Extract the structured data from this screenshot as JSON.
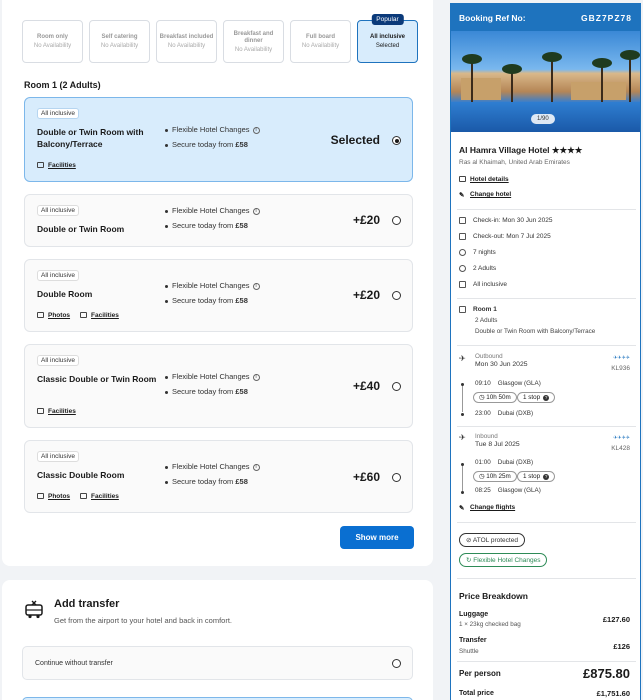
{
  "boards": [
    {
      "name": "Room only",
      "status": "No Availability"
    },
    {
      "name": "Self catering",
      "status": "No Availability"
    },
    {
      "name": "Breakfast included",
      "status": "No Availability"
    },
    {
      "name": "Breakfast and dinner",
      "status": "No Availability"
    },
    {
      "name": "Full board",
      "status": "No Availability"
    },
    {
      "name": "All inclusive",
      "status": "Selected",
      "badge": "Popular"
    }
  ],
  "room_heading": "Room 1 (2 Adults)",
  "rooms": [
    {
      "tag": "All inclusive",
      "name": "Double or Twin Room with Balcony/Terrace",
      "feature1": "Flexible Hotel Changes",
      "feature2_prefix": "Secure today from",
      "feature2_price": "£58",
      "price": "Selected",
      "links": [
        "Facilities"
      ]
    },
    {
      "tag": "All inclusive",
      "name": "Double or Twin Room",
      "feature1": "Flexible Hotel Changes",
      "feature2_prefix": "Secure today from",
      "feature2_price": "£58",
      "price": "+£20",
      "links": []
    },
    {
      "tag": "All inclusive",
      "name": "Double Room",
      "feature1": "Flexible Hotel Changes",
      "feature2_prefix": "Secure today from",
      "feature2_price": "£58",
      "price": "+£20",
      "links": [
        "Photos",
        "Facilities"
      ]
    },
    {
      "tag": "All inclusive",
      "name": "Classic Double or Twin Room",
      "feature1": "Flexible Hotel Changes",
      "feature2_prefix": "Secure today from",
      "feature2_price": "£58",
      "price": "+£40",
      "links": [
        "Facilities"
      ]
    },
    {
      "tag": "All inclusive",
      "name": "Classic Double Room",
      "feature1": "Flexible Hotel Changes",
      "feature2_prefix": "Secure today from",
      "feature2_price": "£58",
      "price": "+£60",
      "links": [
        "Photos",
        "Facilities"
      ]
    }
  ],
  "show_more": "Show more",
  "transfer": {
    "title": "Add transfer",
    "subtitle": "Get from the airport to your hotel and back in comfort.",
    "option1": "Continue without transfer"
  },
  "booking": {
    "ref_label": "Booking Ref No:",
    "ref_code": "GBZ7PZ78",
    "image_count": "1/90",
    "hotel_name": "Al Hamra Village Hotel",
    "stars": "★★★★",
    "location": "Ras al Khaimah, United Arab Emirates",
    "hotel_details": "Hotel details",
    "change_hotel": "Change hotel",
    "check_in": "Check-in: Mon 30 Jun 2025",
    "check_out": "Check-out: Mon 7 Jul 2025",
    "nights": "7 nights",
    "adults": "2 Adults",
    "board": "All inclusive",
    "room_title": "Room 1",
    "room_adults": "2 Adults",
    "room_type": "Double or Twin Room with Balcony/Terrace",
    "outbound": {
      "label": "Outbound",
      "date": "Mon 30 Jun 2025",
      "flight": "KL936",
      "dep_time": "09:10",
      "dep_airport": "Glasgow (GLA)",
      "duration": "10h 50m",
      "stops": "1 stop",
      "arr_time": "23:00",
      "arr_airport": "Dubai (DXB)"
    },
    "inbound": {
      "label": "Inbound",
      "date": "Tue 8 Jul 2025",
      "flight": "KL428",
      "dep_time": "01:00",
      "dep_airport": "Dubai (DXB)",
      "duration": "10h 25m",
      "stops": "1 stop",
      "arr_time": "08:25",
      "arr_airport": "Glasgow (GLA)"
    },
    "change_flights": "Change flights",
    "atol": "ATOL protected",
    "flex": "Flexible Hotel Changes",
    "price_breakdown": "Price Breakdown",
    "luggage_label": "Luggage",
    "luggage_sub": "1 × 23kg checked bag",
    "luggage_price": "£127.60",
    "transfer_label": "Transfer",
    "transfer_sub": "Shuttle",
    "transfer_price": "£126",
    "per_person_label": "Per person",
    "per_person_price": "£875.80",
    "total_label": "Total price",
    "total_price": "£1,751.60"
  },
  "colors": {
    "primary": "#1e73be",
    "button": "#0a6fd1",
    "selected_bg": "#d8ecfc",
    "popular": "#0b3a7a"
  }
}
